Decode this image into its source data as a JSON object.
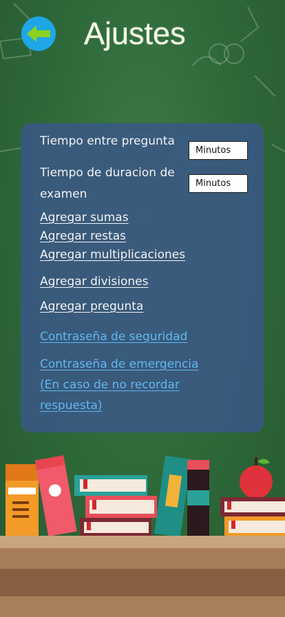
{
  "header": {
    "title": "Ajustes",
    "back_icon": "arrow-left-icon"
  },
  "settings": {
    "question_interval_label": "Tiempo entre pregunta",
    "question_interval_value": "Minutos",
    "exam_duration_label": "Tiempo de duracion de examen",
    "exam_duration_value": "Minutos"
  },
  "links": {
    "add_sums": "Agregar sumas",
    "add_subtractions": "Agregar restas",
    "add_multiplications": "Agregar multiplicaciones",
    "add_divisions": "Agregar divisiones",
    "add_question": "Agregar pregunta",
    "security_password": "Contraseña de seguridad",
    "emergency_password": "Contraseña de emergencia (En caso de no recordar respuesta)"
  },
  "colors": {
    "board_green": "#2f6a3a",
    "panel_blue": "#3a5884",
    "back_button": "#1ea6e6",
    "arrow": "#8bd11f",
    "link_blue": "#62b7f0"
  }
}
